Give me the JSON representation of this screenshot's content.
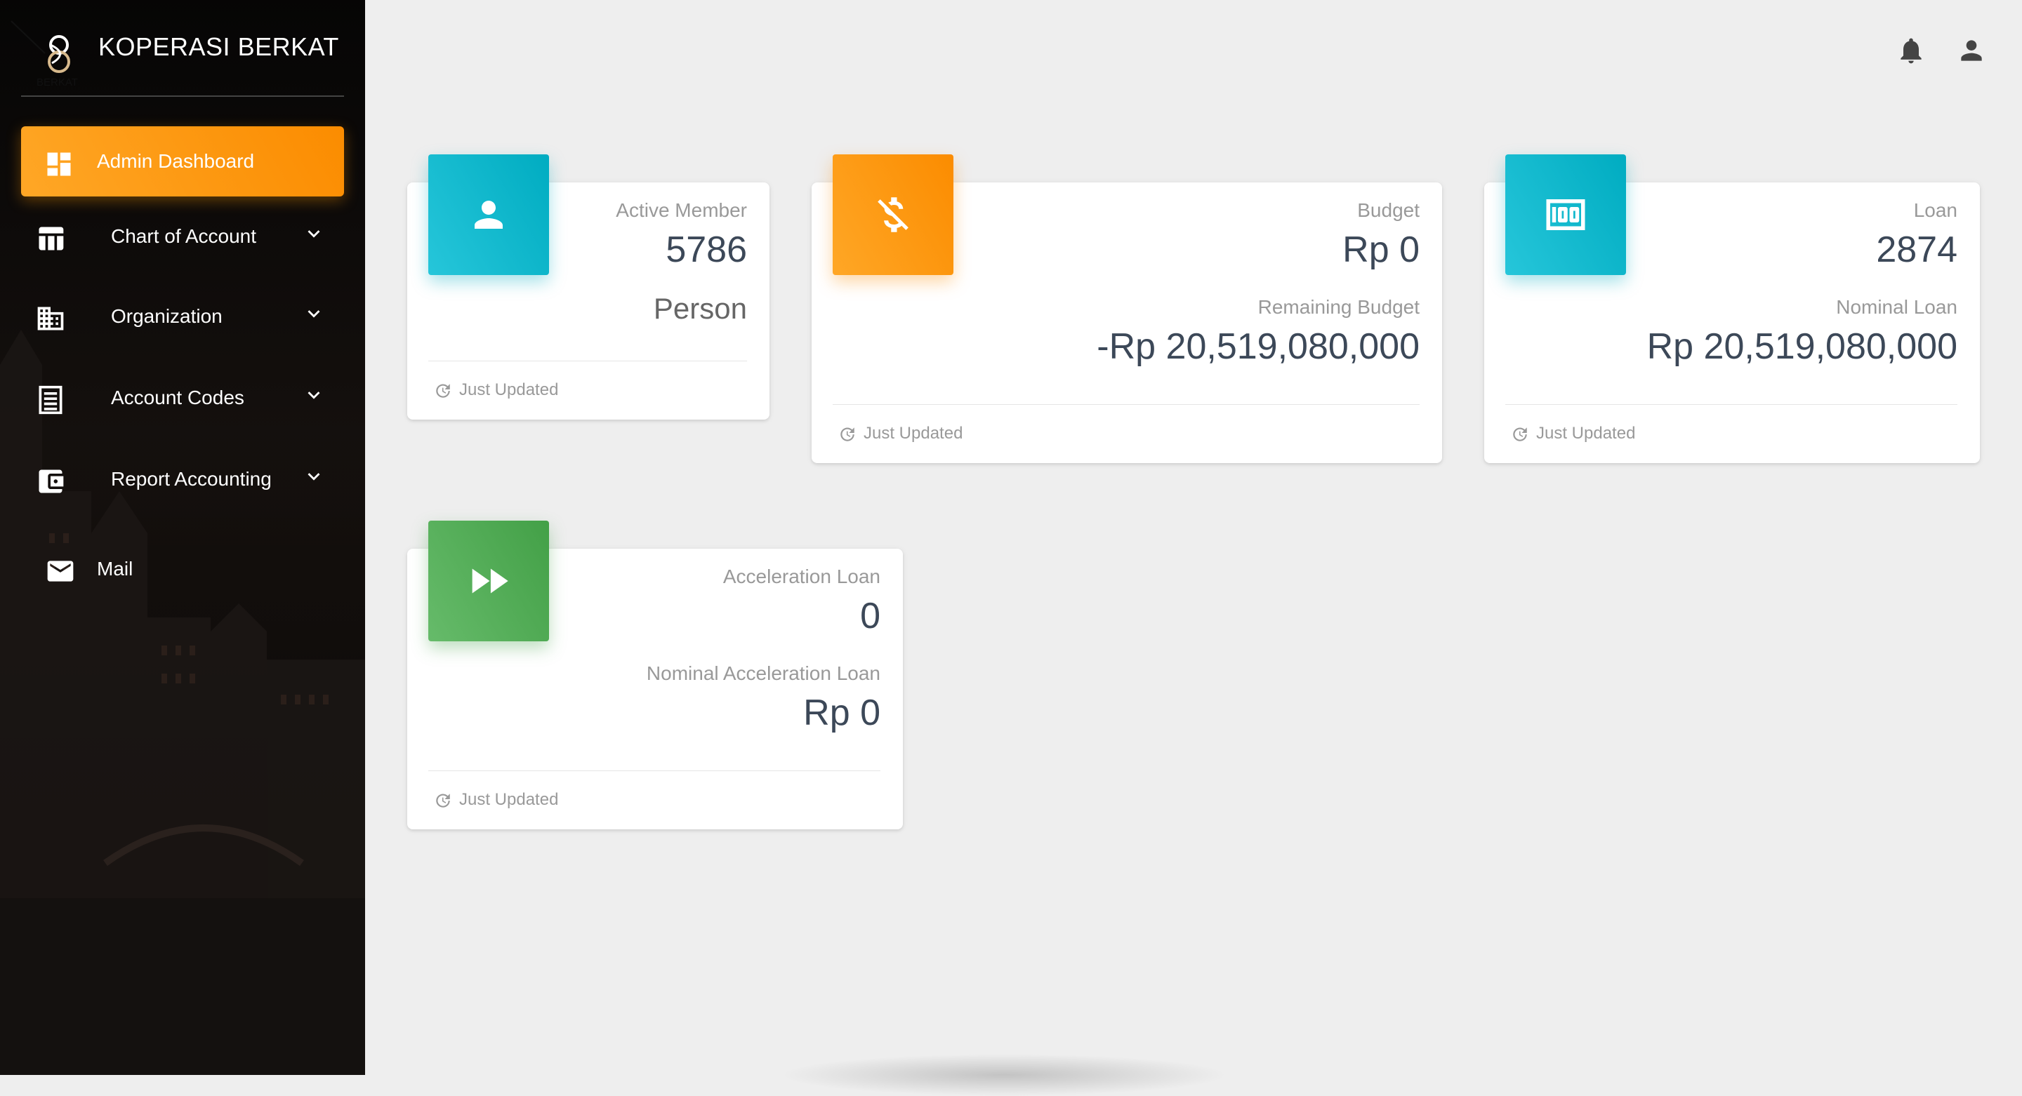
{
  "brand": {
    "name": "KOPERASI BERKAT",
    "logo_text": "BERKAT"
  },
  "colors": {
    "sidebar_active": "#ff9800",
    "card_cyan": "#00acc1",
    "card_orange": "#fb8c00",
    "card_green": "#43a047"
  },
  "sidebar": {
    "items": [
      {
        "label": "Admin Dashboard",
        "icon": "dashboard-icon",
        "active": true
      },
      {
        "label": "Chart of Account",
        "icon": "table-icon",
        "expandable": true
      },
      {
        "label": "Organization",
        "icon": "building-icon",
        "expandable": true
      },
      {
        "label": "Account Codes",
        "icon": "list-icon",
        "expandable": true
      },
      {
        "label": "Report Accounting",
        "icon": "wallet-icon",
        "expandable": true
      },
      {
        "label": "Mail",
        "icon": "mail-icon"
      }
    ]
  },
  "topbar": {
    "icons": [
      "notification-bell-icon",
      "user-account-icon"
    ]
  },
  "cards": {
    "active_member": {
      "category": "Active Member",
      "value": "5786",
      "unit": "Person",
      "footer": "Just Updated",
      "icon": "person-icon"
    },
    "budget": {
      "category": "Budget",
      "value": "Rp 0",
      "sub_category": "Remaining Budget",
      "sub_value": "-Rp 20,519,080,000",
      "footer": "Just Updated",
      "icon": "dollar-sign-icon"
    },
    "loan": {
      "category": "Loan",
      "value": "2874",
      "sub_category": "Nominal Loan",
      "sub_value": "Rp 20,519,080,000",
      "footer": "Just Updated",
      "icon": "money-bill-icon"
    },
    "acceleration_loan": {
      "category": "Acceleration Loan",
      "value": "0",
      "sub_category": "Nominal Acceleration Loan",
      "sub_value": "Rp 0",
      "footer": "Just Updated",
      "icon": "fast-forward-icon"
    }
  }
}
